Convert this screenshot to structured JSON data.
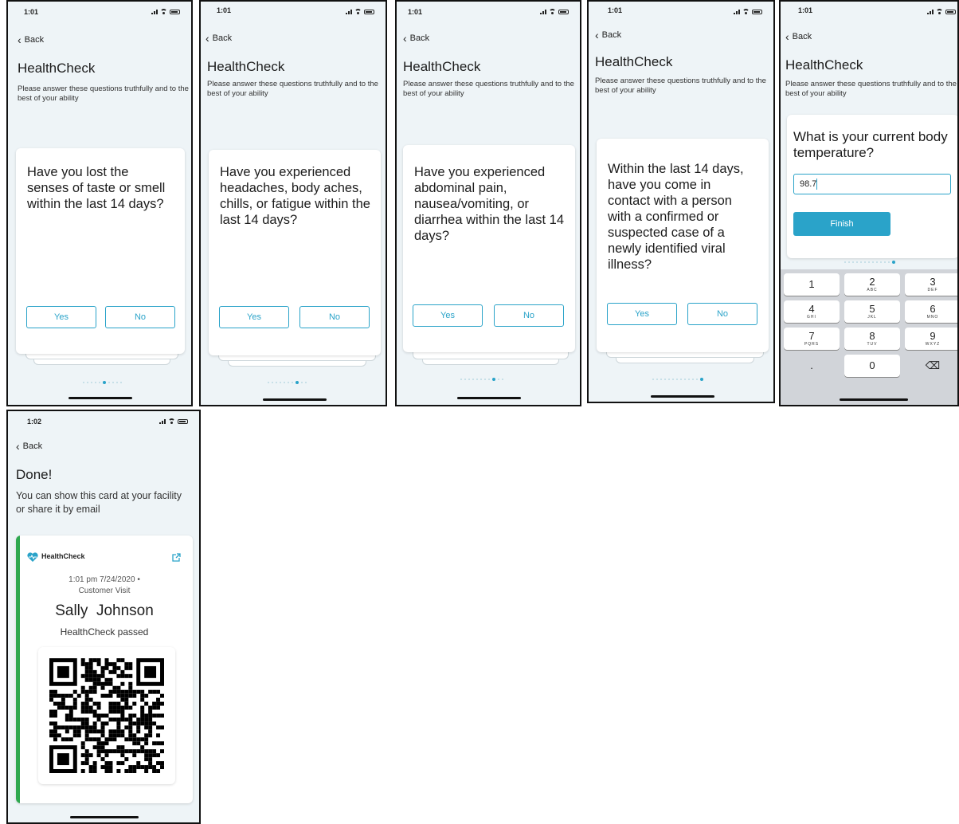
{
  "common": {
    "back_label": "Back",
    "app_title": "HealthCheck",
    "instructions": "Please answer these questions truthfully and to the best of your ability",
    "yes_label": "Yes",
    "no_label": "No"
  },
  "screens": [
    {
      "time": "1:01",
      "question": "Have you lost the senses of taste or smell within the last 14 days?"
    },
    {
      "time": "1:01",
      "question": "Have you experienced headaches, body aches, chills, or fatigue within the last 14 days?"
    },
    {
      "time": "1:01",
      "question": "Have you experienced abdominal pain, nausea/vomiting, or diarrhea within the last 14 days?"
    },
    {
      "time": "1:01",
      "question": "Within the last 14 days, have you come in contact with a person with a confirmed or suspected case of a newly identified viral illness?"
    },
    {
      "time": "1:01",
      "question": "What is your current body temperature?",
      "input_value": "98.7",
      "finish_label": "Finish"
    }
  ],
  "keypad": [
    {
      "n": "1",
      "l": ""
    },
    {
      "n": "2",
      "l": "ABC"
    },
    {
      "n": "3",
      "l": "DEF"
    },
    {
      "n": "4",
      "l": "GHI"
    },
    {
      "n": "5",
      "l": "JKL"
    },
    {
      "n": "6",
      "l": "MNO"
    },
    {
      "n": "7",
      "l": "PQRS"
    },
    {
      "n": "8",
      "l": "TUV"
    },
    {
      "n": "9",
      "l": "WXYZ"
    },
    {
      "n": ".",
      "l": ""
    },
    {
      "n": "0",
      "l": ""
    },
    {
      "n": "⌫",
      "l": ""
    }
  ],
  "done": {
    "time": "1:02",
    "title": "Done!",
    "subtitle": "You can show this card at your facility or share it by email",
    "brand": "HealthCheck",
    "timestamp": "1:01 pm 7/24/2020 •",
    "visit_type": "Customer Visit",
    "name": "Sally  Johnson",
    "status": "HealthCheck passed"
  },
  "colors": {
    "accent": "#2aa3c9",
    "pass": "#2fa84f",
    "background": "#eef4f7"
  }
}
